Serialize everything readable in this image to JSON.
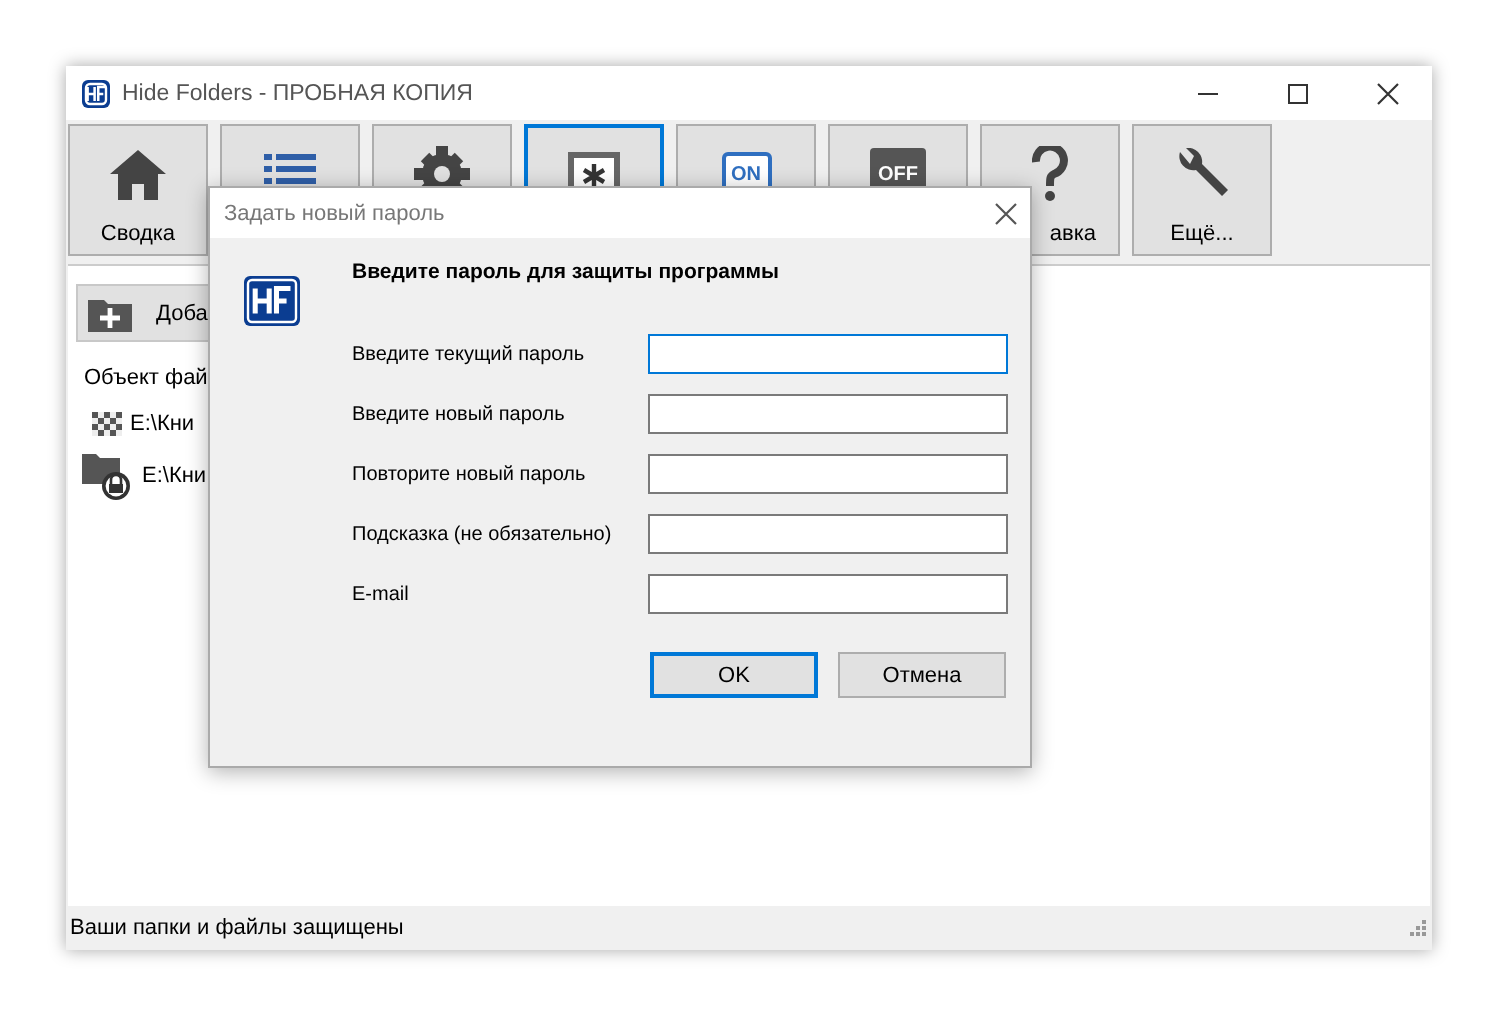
{
  "window": {
    "title": "Hide Folders - ПРОБНАЯ КОПИЯ"
  },
  "toolbar": [
    {
      "label": "Сводка",
      "selected": false
    },
    {
      "selected": false
    },
    {
      "selected": false
    },
    {
      "selected": true
    },
    {
      "icon_text": "ON",
      "selected": false
    },
    {
      "icon_text": "OFF",
      "selected": false
    },
    {
      "label": "авка",
      "label_cut_left": true,
      "selected": false
    },
    {
      "label": "Ещё...",
      "selected": false
    }
  ],
  "panel": {
    "add_button": "Доба",
    "header": "Объект фай",
    "items": [
      {
        "kind": "checker",
        "path": "E:\\Кни"
      },
      {
        "kind": "locked",
        "path": "E:\\Кни"
      }
    ]
  },
  "status_bar": "Ваши папки и файлы защищены",
  "dialog": {
    "title": "Задать новый пароль",
    "heading": "Введите пароль для защиты программы",
    "fields": [
      {
        "label": "Введите текущий пароль",
        "focused": true
      },
      {
        "label": "Введите новый пароль",
        "focused": false
      },
      {
        "label": "Повторите новый пароль",
        "focused": false
      },
      {
        "label": "Подсказка (не обязательно)",
        "focused": false
      },
      {
        "label": "E-mail",
        "focused": false
      }
    ],
    "buttons": [
      {
        "label": "OK",
        "default": true
      },
      {
        "label": "Отмена",
        "default": false
      }
    ]
  }
}
